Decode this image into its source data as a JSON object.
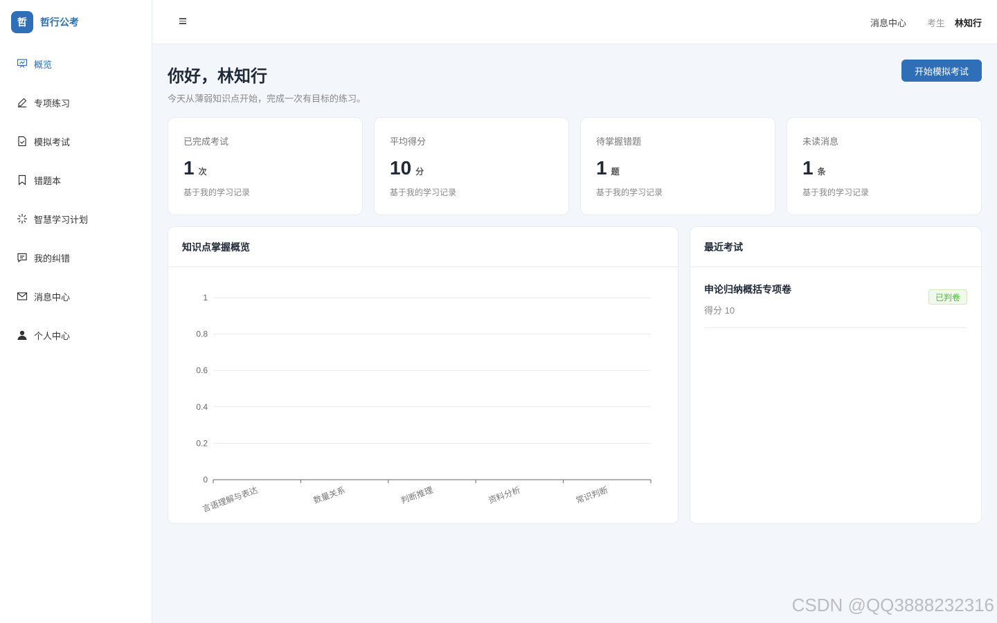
{
  "brand": {
    "logo_char": "哲",
    "name": "哲行公考"
  },
  "sidebar": {
    "items": [
      {
        "label": "概览",
        "icon": "presentation-icon"
      },
      {
        "label": "专项练习",
        "icon": "pen-icon"
      },
      {
        "label": "模拟考试",
        "icon": "file-check-icon"
      },
      {
        "label": "错题本",
        "icon": "bookmark-icon"
      },
      {
        "label": "智慧学习计划",
        "icon": "sparkle-icon"
      },
      {
        "label": "我的纠错",
        "icon": "comment-icon"
      },
      {
        "label": "消息中心",
        "icon": "mail-icon"
      },
      {
        "label": "个人中心",
        "icon": "user-icon"
      }
    ]
  },
  "header": {
    "message_center": "消息中心",
    "role": "考生",
    "user_name": "林知行"
  },
  "main": {
    "greeting": "你好，林知行",
    "subtitle": "今天从薄弱知识点开始，完成一次有目标的练习。",
    "start_button": "开始模拟考试"
  },
  "stats": [
    {
      "label": "已完成考试",
      "value": "1",
      "unit": "次",
      "note": "基于我的学习记录"
    },
    {
      "label": "平均得分",
      "value": "10",
      "unit": "分",
      "note": "基于我的学习记录"
    },
    {
      "label": "待掌握错题",
      "value": "1",
      "unit": "题",
      "note": "基于我的学习记录"
    },
    {
      "label": "未读消息",
      "value": "1",
      "unit": "条",
      "note": "基于我的学习记录"
    }
  ],
  "knowledge_card": {
    "title": "知识点掌握概览"
  },
  "chart_data": {
    "type": "bar",
    "title": "知识点掌握概览",
    "categories": [
      "言语理解与表达",
      "数量关系",
      "判断推理",
      "资料分析",
      "常识判断"
    ],
    "values": [
      0,
      0,
      0,
      0,
      0
    ],
    "ylim": [
      0,
      1
    ],
    "yticks": [
      "0",
      "0.2",
      "0.4",
      "0.6",
      "0.8",
      "1"
    ],
    "grid": true
  },
  "recent": {
    "title": "最近考试",
    "items": [
      {
        "name": "申论归纳概括专项卷",
        "score": "得分 10",
        "status": "已判卷"
      }
    ]
  },
  "watermark": "CSDN @QQ3888232316",
  "colors": {
    "accent": "#2f6fb8",
    "success": "#5ab14a"
  }
}
